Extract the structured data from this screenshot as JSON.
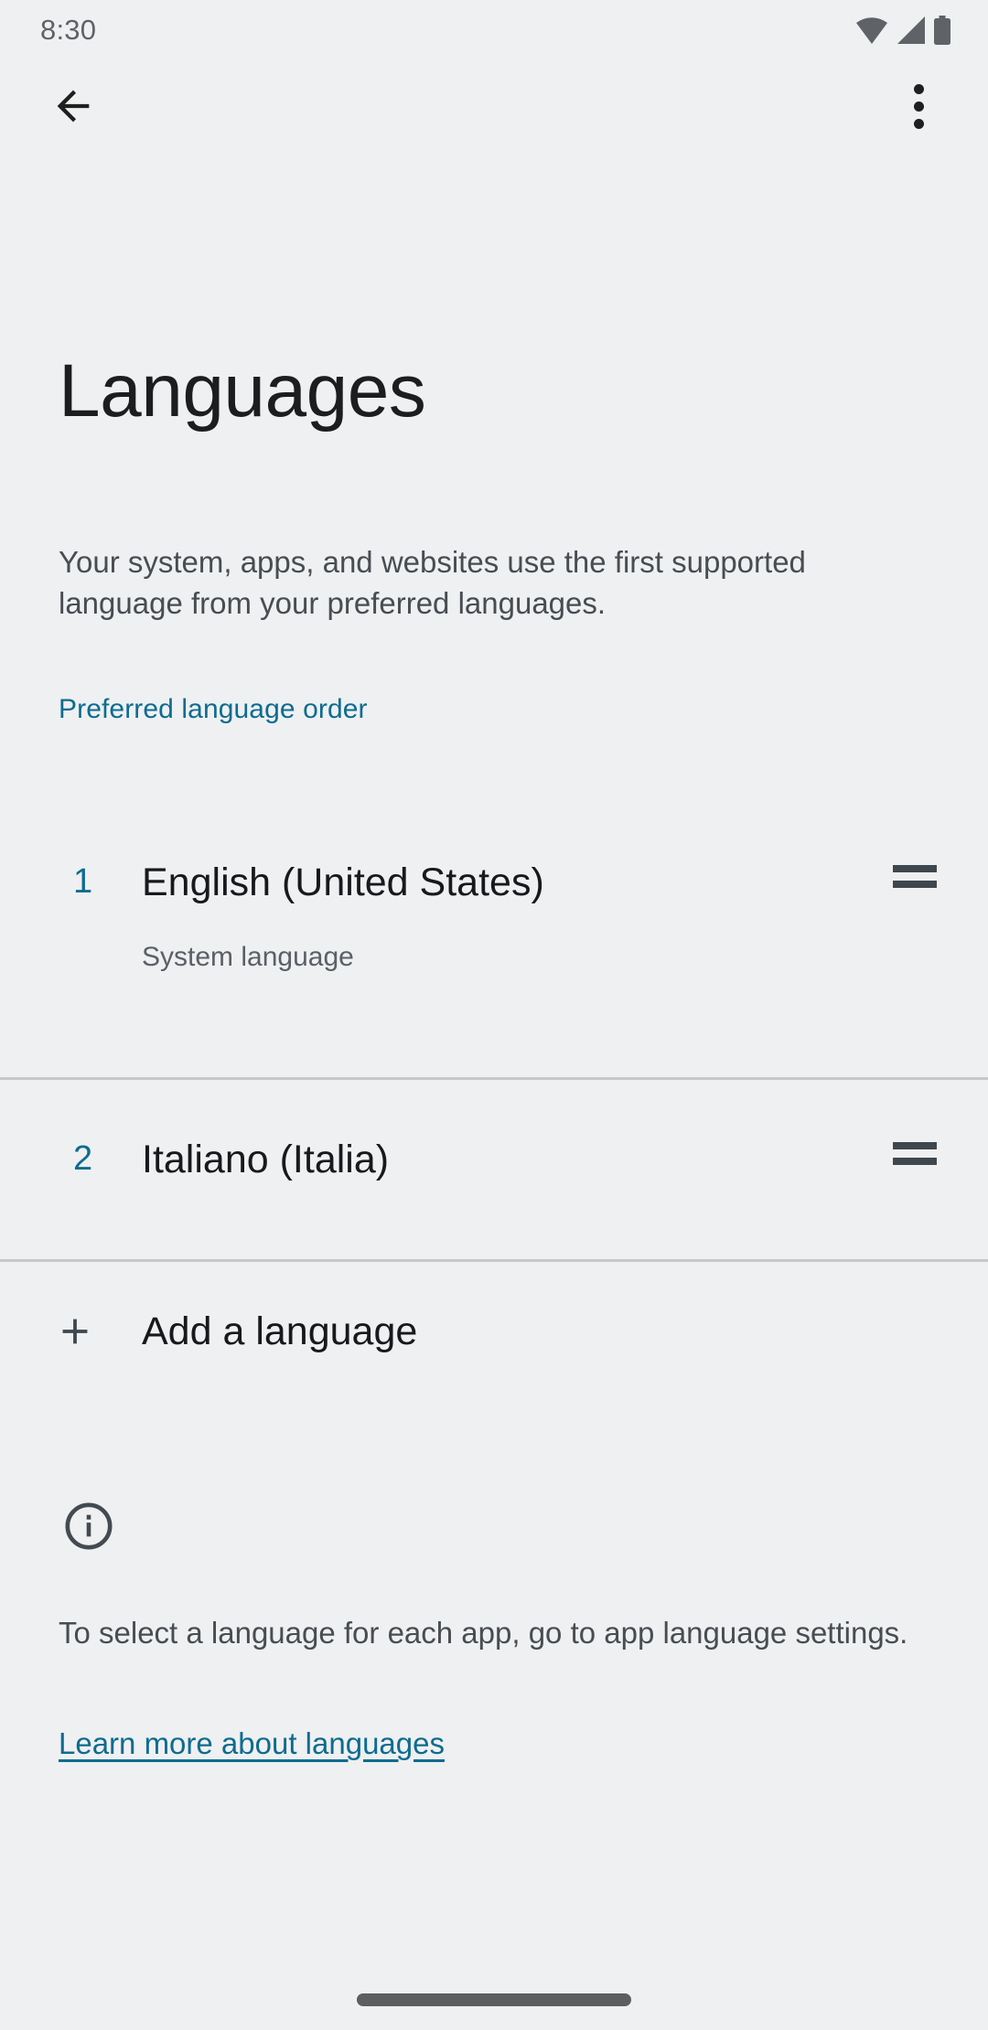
{
  "status_bar": {
    "time": "8:30",
    "icons": [
      "wifi-icon",
      "cellular-signal-icon",
      "battery-icon"
    ]
  },
  "app_bar": {
    "back_icon": "back-arrow-icon",
    "overflow_icon": "more-options-icon"
  },
  "page": {
    "title": "Languages",
    "description": "Your system, apps, and websites use the first supported language from your preferred languages."
  },
  "section": {
    "header": "Preferred language order"
  },
  "languages": [
    {
      "index": "1",
      "name": "English (United States)",
      "subtitle": "System language",
      "drag_icon": "drag-handle-icon"
    },
    {
      "index": "2",
      "name": "Italiano (Italia)",
      "subtitle": "",
      "drag_icon": "drag-handle-icon"
    }
  ],
  "add_language": {
    "label": "Add a language",
    "icon": "plus-icon"
  },
  "footer": {
    "icon": "info-icon",
    "text": "To select a language for each app, go to app language settings.",
    "link": "Learn more about languages"
  },
  "colors": {
    "background": "#eff0f1",
    "accent": "#0d6c8f",
    "primary_text": "#17191c",
    "secondary_text": "#474d52",
    "divider": "#c7c8ca",
    "icon": "#3f474e"
  }
}
